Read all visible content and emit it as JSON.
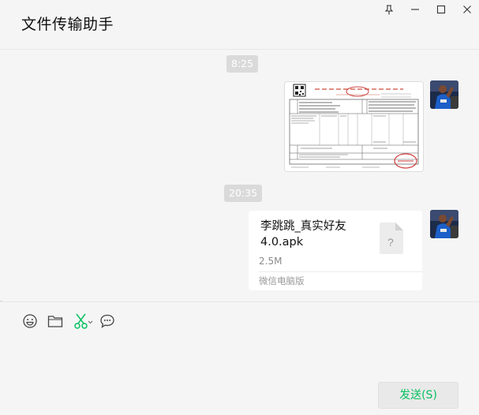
{
  "window": {
    "title": "文件传输助手",
    "controls": [
      "pin-icon",
      "minimize-icon",
      "maximize-icon",
      "close-icon"
    ]
  },
  "chat": {
    "messages": [
      {
        "type": "time",
        "text": "8:25"
      },
      {
        "type": "image",
        "sender": "self",
        "content": "invoice-image"
      },
      {
        "type": "time",
        "text": "20:35"
      },
      {
        "type": "file",
        "sender": "self",
        "file_name": "李跳跳_真实好友4.0.apk",
        "file_size": "2.5M",
        "source": "微信电脑版",
        "icon": "unknown-file-icon"
      }
    ]
  },
  "toolbar": {
    "icons": [
      "emoji-icon",
      "folder-icon",
      "scissors-icon",
      "chat-bubble-icon"
    ]
  },
  "composer": {
    "send_label": "发送(S)"
  },
  "colors": {
    "background": "#f5f5f5",
    "time_badge": "#dadada",
    "send_text": "#07c160",
    "scissors": "#07c160"
  }
}
